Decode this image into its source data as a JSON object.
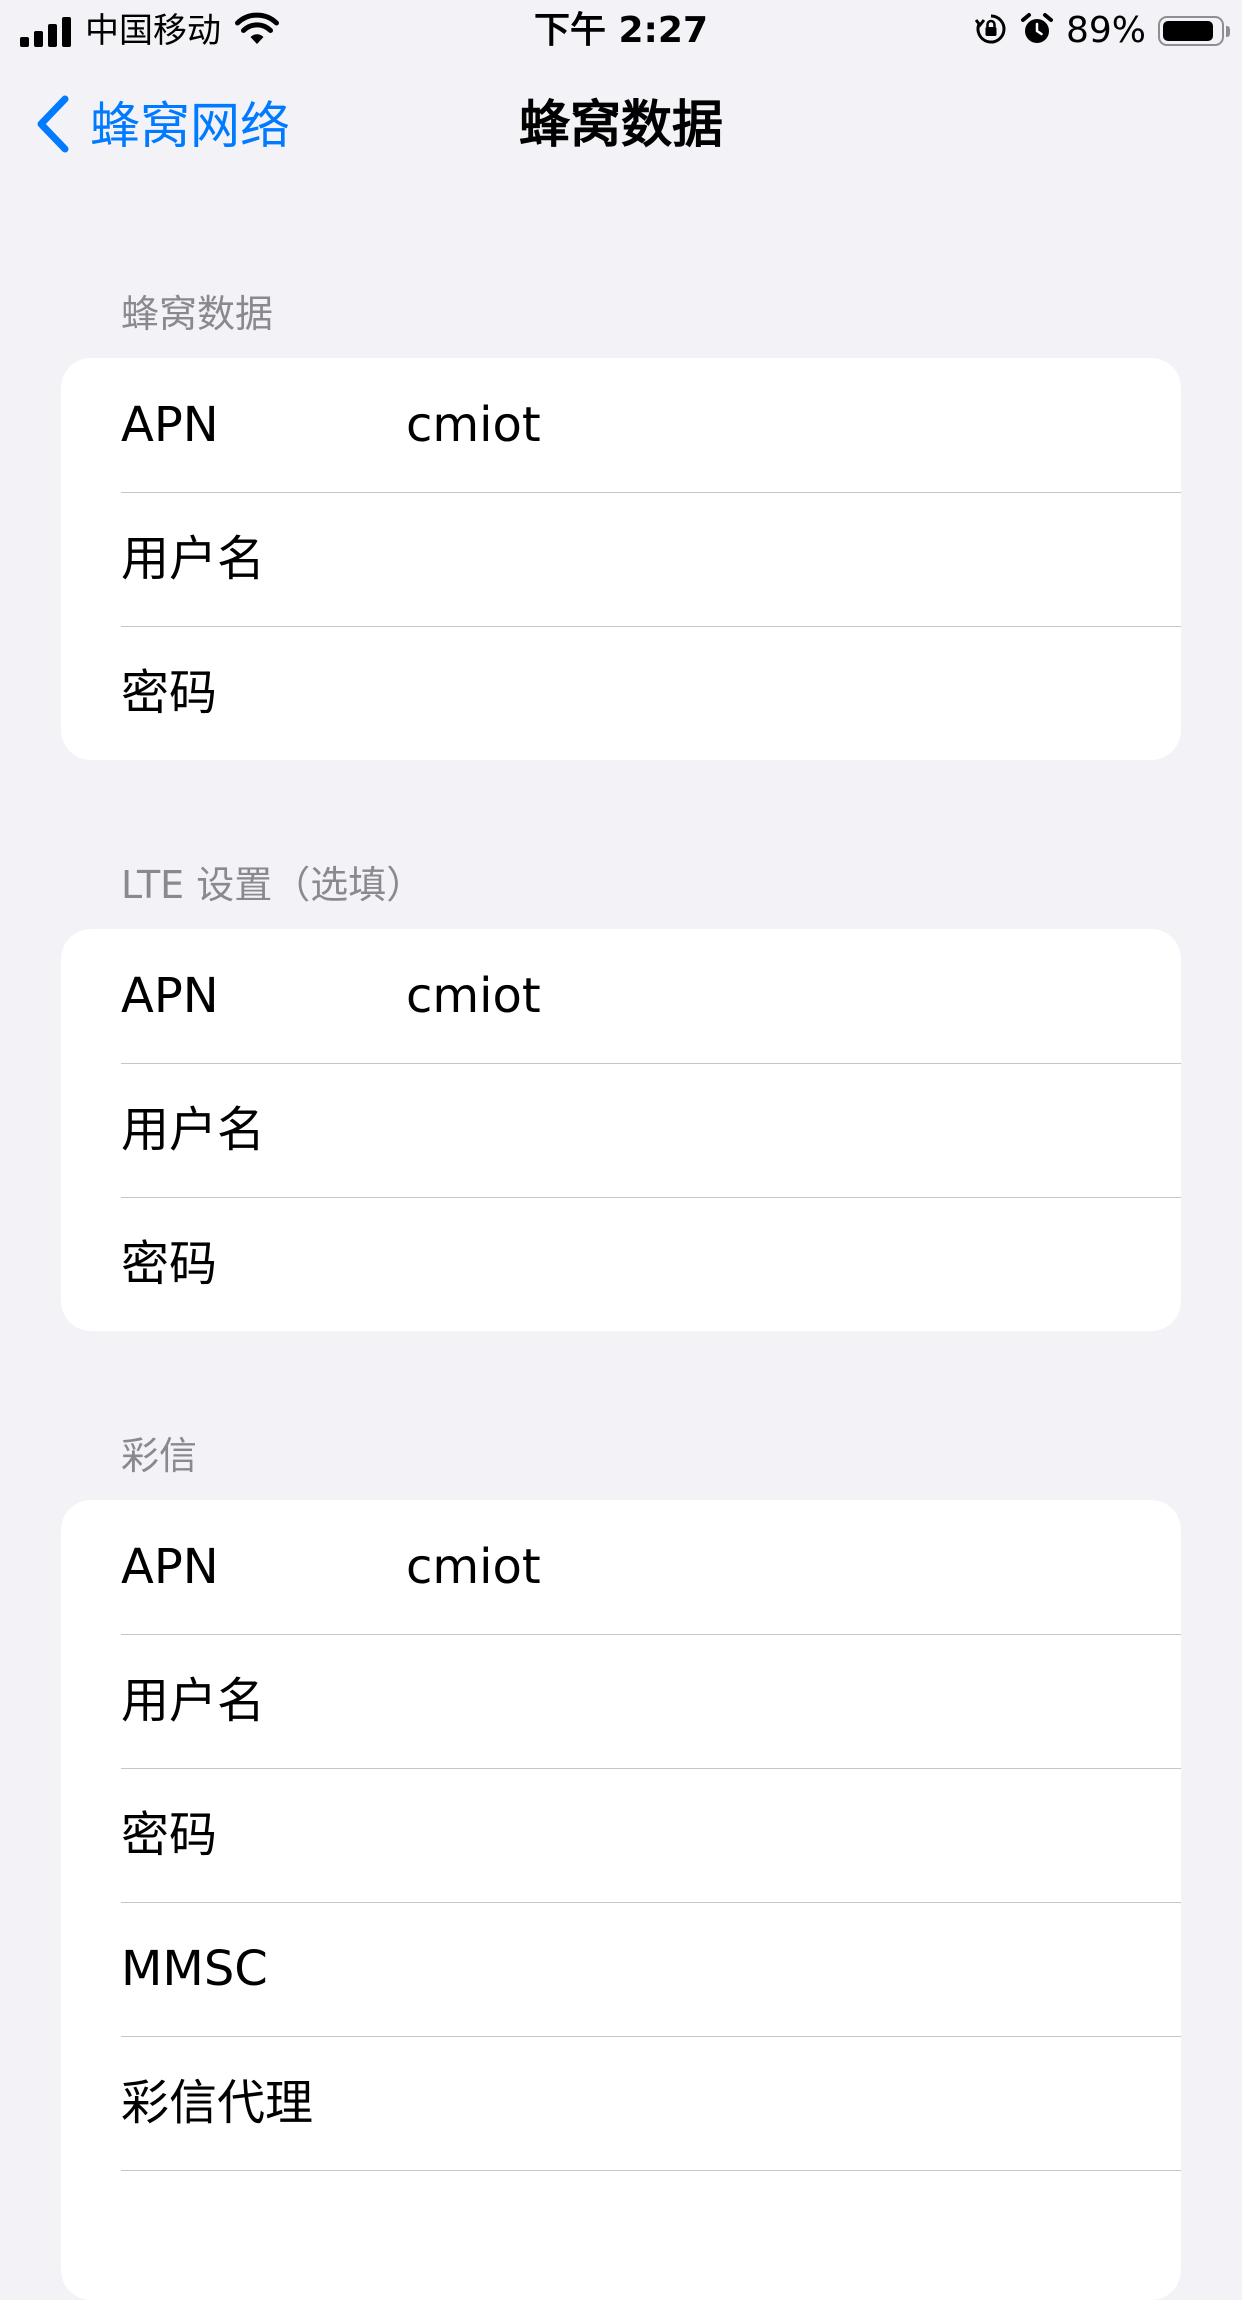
{
  "status_bar": {
    "carrier": "中国移动",
    "time": "下午 2:27",
    "battery_percent": "89%",
    "battery_level": 0.89
  },
  "nav": {
    "back_label": "蜂窝网络",
    "title": "蜂窝数据"
  },
  "sections": [
    {
      "header": "蜂窝数据",
      "rows": [
        {
          "label": "APN",
          "value": "cmiot"
        },
        {
          "label": "用户名",
          "value": ""
        },
        {
          "label": "密码",
          "value": ""
        }
      ]
    },
    {
      "header": "LTE 设置（选填）",
      "rows": [
        {
          "label": "APN",
          "value": "cmiot"
        },
        {
          "label": "用户名",
          "value": ""
        },
        {
          "label": "密码",
          "value": ""
        }
      ]
    },
    {
      "header": "彩信",
      "rows": [
        {
          "label": "APN",
          "value": "cmiot"
        },
        {
          "label": "用户名",
          "value": ""
        },
        {
          "label": "密码",
          "value": ""
        },
        {
          "label": "MMSC",
          "value": ""
        },
        {
          "label": "彩信代理",
          "value": ""
        }
      ]
    }
  ],
  "colors": {
    "accent": "#007aff",
    "background": "#f2f2f7",
    "card": "#ffffff",
    "header_text": "#8a8a8e",
    "separator": "#c6c6c8"
  }
}
